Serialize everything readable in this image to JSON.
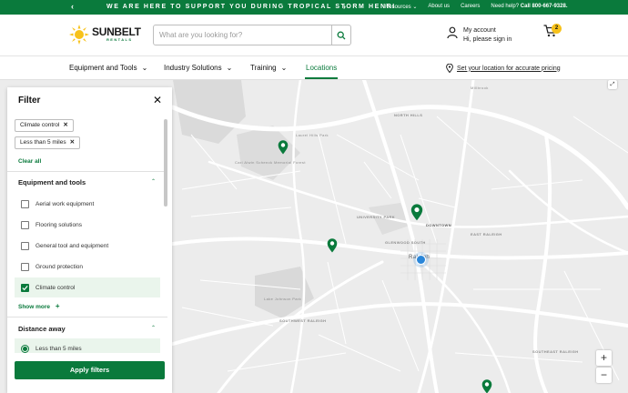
{
  "promo": {
    "message": "WE ARE HERE TO SUPPORT YOU DURING TROPICAL STORM HENRI",
    "prev": "‹",
    "next": "›",
    "links": [
      "Resources ⌄",
      "About us",
      "Careers"
    ],
    "help_label": "Need help?",
    "help_phone": "Call 800-667-9328."
  },
  "header": {
    "brand": "SUNBELT",
    "brand_sub": "RENTALS",
    "search_placeholder": "What are you looking for?",
    "account_title": "My account",
    "account_sub": "Hi, please sign in",
    "cart_count": "2"
  },
  "nav": {
    "items": [
      {
        "label": "Equipment and Tools",
        "caret": "⌄"
      },
      {
        "label": "Industry Solutions",
        "caret": "⌄"
      },
      {
        "label": "Training",
        "caret": "⌄"
      },
      {
        "label": "Locations",
        "caret": ""
      }
    ],
    "location_link": "Set your location for accurate pricing"
  },
  "map": {
    "labels": [
      "Millbrook",
      "NORTH HILLS",
      "Laurel Hills Park",
      "Carl Alwin Schenck Memorial Forest",
      "UNIVERSITY PARK",
      "GLENWOOD SOUTH",
      "DOWNTOWN",
      "EAST RALEIGH",
      "Raleigh",
      "Lake Johnson Park",
      "SOUTHEAST RALEIGH",
      "SOUTHWEST RALEIGH"
    ],
    "zoom_in": "+",
    "zoom_out": "−",
    "fullscreen": "⤢",
    "brand_color": "#0a7a3c",
    "user_color": "#2a86d9"
  },
  "filter": {
    "title": "Filter",
    "close": "✕",
    "chips": [
      {
        "label": "Climate control",
        "x": "✕"
      },
      {
        "label": "Less than 5 miles",
        "x": "✕"
      }
    ],
    "clear_all": "Clear all",
    "equipment_title": "Equipment and tools",
    "equipment_caret": "⌃",
    "options": [
      {
        "label": "Aerial work equipment",
        "checked": false
      },
      {
        "label": "Flooring solutions",
        "checked": false
      },
      {
        "label": "General tool and equipment",
        "checked": false
      },
      {
        "label": "Ground protection",
        "checked": false
      },
      {
        "label": "Climate control",
        "checked": true
      }
    ],
    "show_more": "Show more",
    "show_more_icon": "+",
    "distance_title": "Distance away",
    "distance_caret": "⌃",
    "distance_selected": "Less than 5 miles",
    "apply": "Apply filters"
  }
}
